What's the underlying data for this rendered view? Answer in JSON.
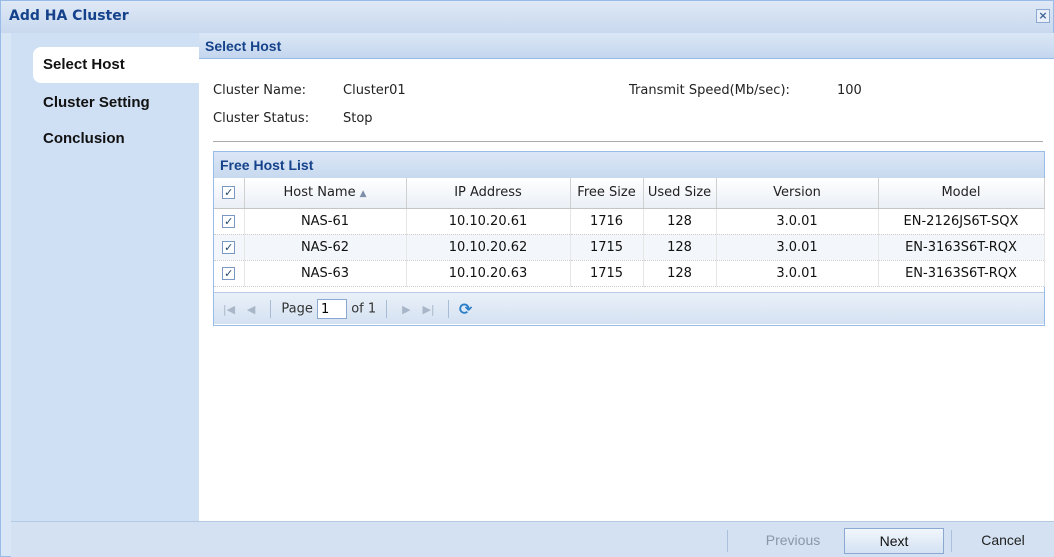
{
  "window": {
    "title": "Add HA Cluster",
    "close_symbol": "×"
  },
  "nav": {
    "items": [
      {
        "label": "Select Host",
        "active": true
      },
      {
        "label": "Cluster Setting",
        "active": false
      },
      {
        "label": "Conclusion",
        "active": false
      }
    ]
  },
  "section": {
    "title": "Select Host"
  },
  "cluster": {
    "name_label": "Cluster Name:",
    "name_value": "Cluster01",
    "status_label": "Cluster Status:",
    "status_value": "Stop",
    "speed_label": "Transmit Speed(Mb/sec):",
    "speed_value": "100"
  },
  "host_list": {
    "title": "Free Host List",
    "columns": [
      "Host Name",
      "IP Address",
      "Free Size",
      "Used Size",
      "Version",
      "Model"
    ],
    "sort_indicator": "▲",
    "rows": [
      {
        "host": "NAS-61",
        "ip": "10.10.20.61",
        "free": "1716",
        "used": "128",
        "version": "3.0.01",
        "model": "EN-2126JS6T-SQX"
      },
      {
        "host": "NAS-62",
        "ip": "10.10.20.62",
        "free": "1715",
        "used": "128",
        "version": "3.0.01",
        "model": "EN-3163S6T-RQX"
      },
      {
        "host": "NAS-63",
        "ip": "10.10.20.63",
        "free": "1715",
        "used": "128",
        "version": "3.0.01",
        "model": "EN-3163S6T-RQX"
      }
    ]
  },
  "pager": {
    "page_label": "Page",
    "page_value": "1",
    "of_label": "of 1"
  },
  "footer": {
    "previous_label": "Previous",
    "next_label": "Next",
    "cancel_label": "Cancel"
  },
  "colors": {
    "accent": "#15428b",
    "panel": "#d9e6f5",
    "border": "#99bbe8"
  }
}
